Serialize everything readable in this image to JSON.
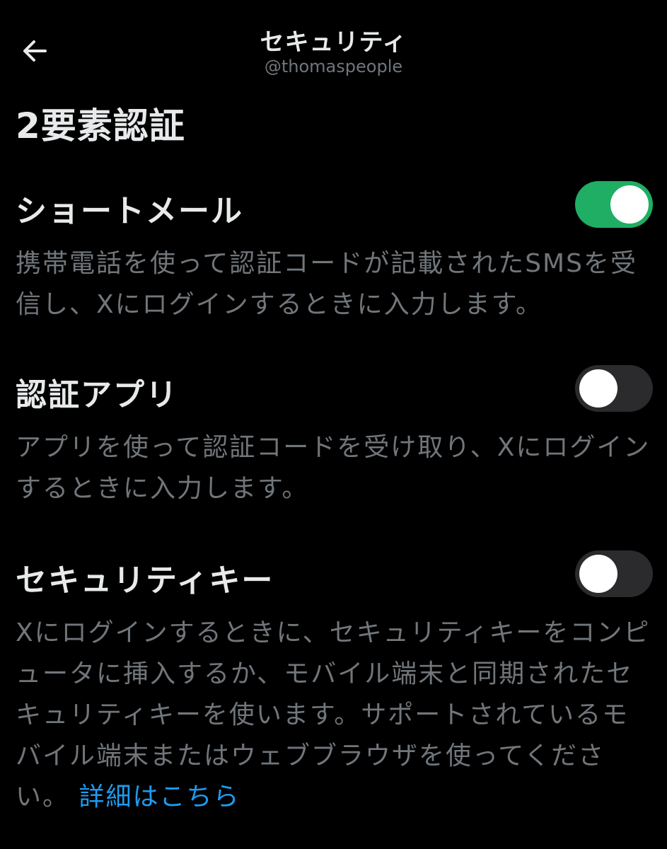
{
  "header": {
    "title": "セキュリティ",
    "handle": "@thomaspeople",
    "back_icon": "arrow-left-icon"
  },
  "section_title": "2要素認証",
  "options": [
    {
      "label": "ショートメール",
      "enabled": true,
      "description": "携帯電話を使って認証コードが記載されたSMSを受信し、Xにログインするときに入力します。"
    },
    {
      "label": "認証アプリ",
      "enabled": false,
      "description": "アプリを使って認証コードを受け取り、Xにログインするときに入力します。"
    },
    {
      "label": "セキュリティキー",
      "enabled": false,
      "description": "Xにログインするときに、セキュリティキーをコンピュータに挿入するか、モバイル端末と同期されたセキュリティキーを使います。サポートされているモバイル端末またはウェブブラウザを使ってください。",
      "link_text": "詳細はこちら"
    }
  ],
  "colors": {
    "background": "#000000",
    "primary_text": "#e7e9ea",
    "secondary_text": "#71767b",
    "toggle_on": "#1fae63",
    "toggle_off": "#2b2b2d",
    "link": "#1d9bf0"
  }
}
